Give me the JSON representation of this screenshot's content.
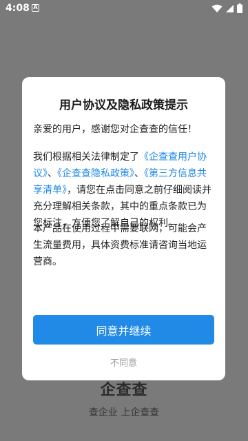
{
  "status_bar": {
    "time": "4:08",
    "notification_glyph": "A"
  },
  "splash": {
    "brand_name": "企查查",
    "slogan": "查企业 上企查查"
  },
  "dialog": {
    "title": "用户协议及隐私政策提示",
    "greeting": "亲爱的用户，感谢您对企查查的信任！",
    "p2_prefix": "我们根据相关法律制定了",
    "link_user_agreement": "《企查查用户协议》",
    "sep1": "、",
    "link_privacy_policy": "《企查查隐私政策》",
    "sep2": "、",
    "link_third_party": "《第三方信息共享清单》",
    "p2_suffix": "，请您在点击同意之前仔细阅读并充分理解相关条款，其中的重点条款已为您标注，方便您了解自己的权利。",
    "p3": "本产品在使用过程中需要联网，可能会产生流量费用，具体资费标准请咨询当地运营商。",
    "agree_label": "同意并继续",
    "disagree_label": "不同意"
  },
  "colors": {
    "accent": "#2189e6",
    "link": "#1e88e5",
    "overlay": "#7a7a7a"
  }
}
